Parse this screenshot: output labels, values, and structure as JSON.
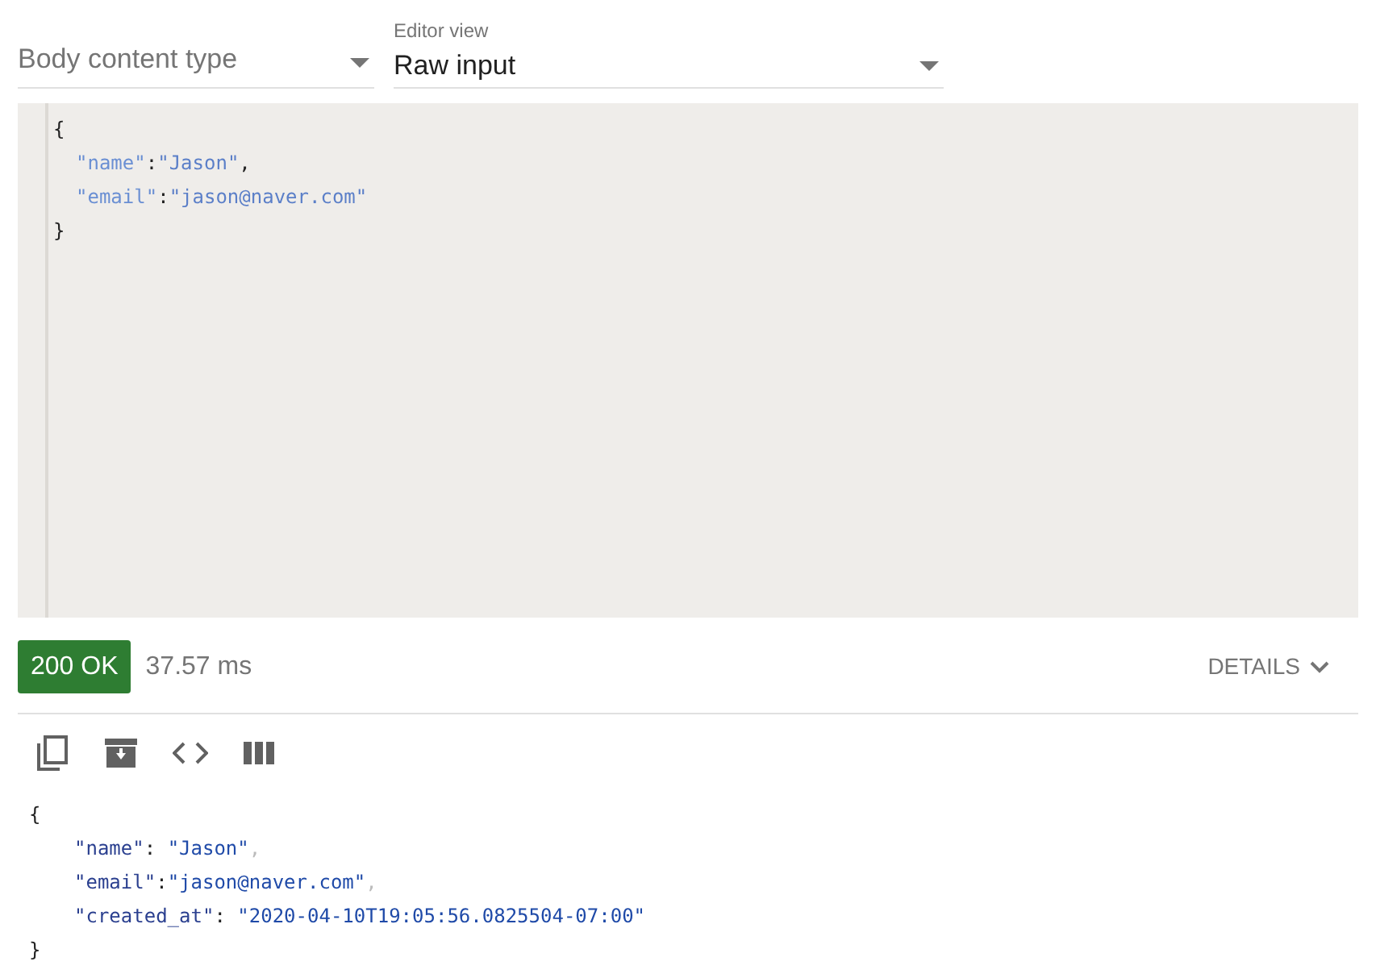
{
  "body_content_type": {
    "placeholder": "Body content type"
  },
  "editor_view": {
    "label": "Editor view",
    "value": "Raw input"
  },
  "editor": {
    "open": "{",
    "close": "}",
    "members": [
      {
        "key": "\"name\"",
        "separator": ":",
        "value": "\"Jason\"",
        "comma": ","
      },
      {
        "key": "\"email\"",
        "separator": ":",
        "value": "\"jason@naver.com\""
      }
    ]
  },
  "response": {
    "status": "200 OK",
    "time": "37.57 ms",
    "details": "DETAILS",
    "open": "{",
    "close": "}",
    "members": [
      {
        "key": "\"name\"",
        "separator": ": ",
        "value": "\"Jason\"",
        "comma": ","
      },
      {
        "key": "\"email\"",
        "separator": ":",
        "value": "\"jason@naver.com\"",
        "comma": ","
      },
      {
        "key": "\"created_at\"",
        "separator": ": ",
        "value": "\"2020-04-10T19:05:56.0825504-07:00\""
      }
    ]
  }
}
